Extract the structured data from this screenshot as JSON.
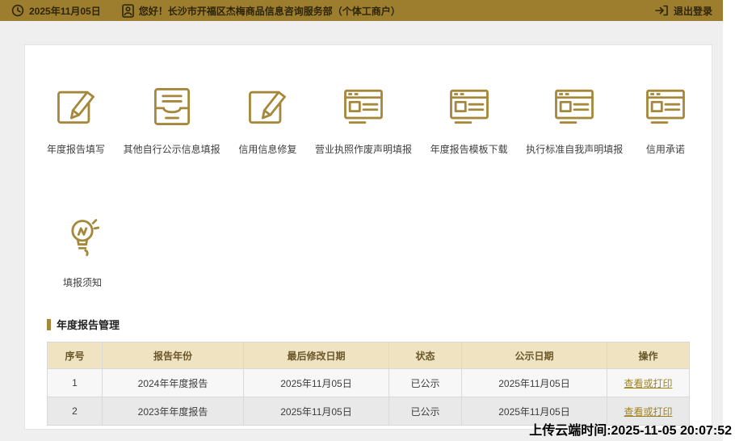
{
  "topbar": {
    "date": "2025年11月05日",
    "greeting": "您好！长沙市开福区杰梅商品信息咨询服务部（个体工商户）",
    "logout_label": "退出登录"
  },
  "quick_actions": [
    {
      "label": "年度报告填写",
      "icon": "edit-pencil-icon"
    },
    {
      "label": "其他自行公示信息填报",
      "icon": "inbox-tray-icon"
    },
    {
      "label": "信用信息修复",
      "icon": "edit-pencil-icon"
    },
    {
      "label": "营业执照作废声明填报",
      "icon": "form-window-icon"
    },
    {
      "label": "年度报告模板下载",
      "icon": "form-window-icon"
    },
    {
      "label": "执行标准自我声明填报",
      "icon": "form-window-icon"
    },
    {
      "label": "信用承诺",
      "icon": "form-window-icon"
    }
  ],
  "notice": {
    "label": "填报须知",
    "icon": "lightbulb-icon"
  },
  "report_section": {
    "title": "年度报告管理",
    "table": {
      "headers": [
        "序号",
        "报告年份",
        "最后修改日期",
        "状态",
        "公示日期",
        "操作"
      ],
      "rows": [
        {
          "no": "1",
          "year": "2024年年度报告",
          "modified": "2025年11月05日",
          "status": "已公示",
          "published": "2025年11月05日",
          "action": "查看或打印"
        },
        {
          "no": "2",
          "year": "2023年年度报告",
          "modified": "2025年11月05日",
          "status": "已公示",
          "published": "2025年11月05日",
          "action": "查看或打印"
        }
      ]
    }
  },
  "footer": {
    "upload_time": "上传云端时间:2025-11-05 20:07:52"
  },
  "colors": {
    "topbar": "#9c7e2e",
    "accent_gold": "#a5883b",
    "table_header_bg": "#f0e3c2",
    "link": "#a0831f"
  }
}
